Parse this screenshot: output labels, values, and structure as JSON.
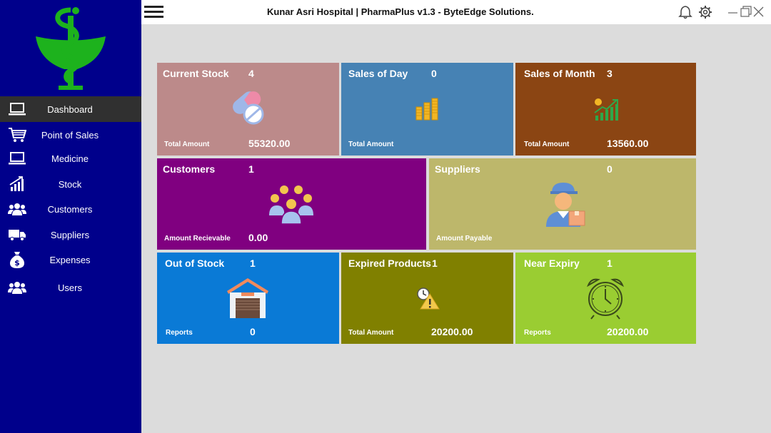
{
  "app": {
    "title": "Kunar Asri Hospital | PharmaPlus v1.3 - ByteEdge Solutions.",
    "logo": "caduceus-pharmacy-logo",
    "accent_sidebar": "#00008b"
  },
  "sidebar": {
    "items": [
      {
        "label": "Dashboard",
        "icon": "laptop-icon"
      },
      {
        "label": "Point of Sales",
        "icon": "cart-icon"
      },
      {
        "label": "Medicine",
        "icon": "laptop-icon"
      },
      {
        "label": "Stock",
        "icon": "growth-chart-icon"
      },
      {
        "label": "Customers",
        "icon": "people-icon"
      },
      {
        "label": "Suppliers",
        "icon": "truck-icon"
      },
      {
        "label": "Expenses",
        "icon": "money-bag-icon"
      },
      {
        "label": "Users",
        "icon": "people-icon"
      }
    ]
  },
  "cards": [
    {
      "title": "Current Stock",
      "count": "4",
      "footer": "Total Amount",
      "amount": "55320.00",
      "color": "#bc8a8a",
      "icon": "pills-icon"
    },
    {
      "title": "Sales of Day",
      "count": "0",
      "footer": "Total Amount",
      "amount": "",
      "color": "#4682b4",
      "icon": "coins-icon"
    },
    {
      "title": "Sales of Month",
      "count": "3",
      "footer": "Total Amount",
      "amount": "13560.00",
      "color": "#8b4513",
      "icon": "growth-chart-icon"
    },
    {
      "title": "Customers",
      "count": "1",
      "footer": "Amount Recievable",
      "amount": "0.00",
      "color": "#800080",
      "icon": "group-icon"
    },
    {
      "title": "Suppliers",
      "count": "0",
      "footer": "Amount Payable",
      "amount": "",
      "color": "#bdb76b",
      "icon": "delivery-man-icon"
    },
    {
      "title": "Out of Stock",
      "count": "1",
      "footer": "Reports",
      "amount": "0",
      "color": "#0a7ad6",
      "icon": "warehouse-icon"
    },
    {
      "title": "Expired Products",
      "count": "1",
      "footer": "Total Amount",
      "amount": "20200.00",
      "color": "#808000",
      "icon": "clock-warning-icon"
    },
    {
      "title": "Near Expiry",
      "count": "1",
      "footer": "Reports",
      "amount": "20200.00",
      "color": "#9acd32",
      "icon": "alarm-clock-icon"
    }
  ]
}
